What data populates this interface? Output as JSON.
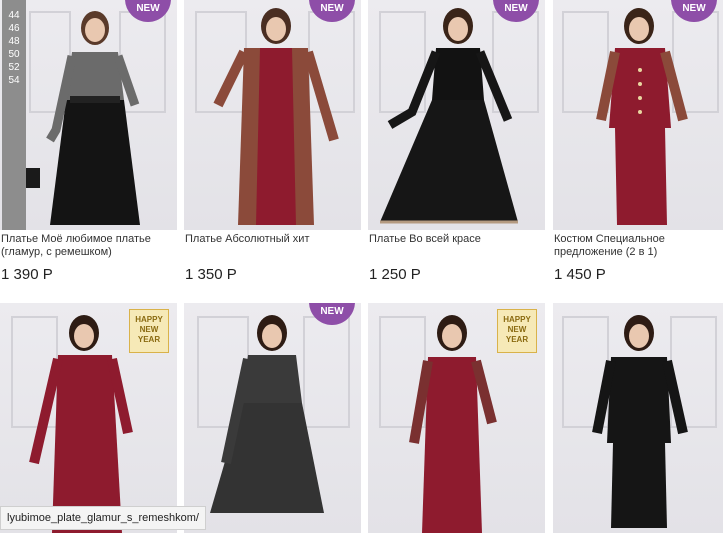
{
  "products": [
    {
      "title": "Платье Моё любимое платье (гламур, с ремешком)",
      "price": "1 390 Р",
      "badge": "NEW"
    },
    {
      "title": "Платье Абсолютный хит",
      "price": "1 350 Р",
      "badge": "NEW"
    },
    {
      "title": "Платье Во всей красе",
      "price": "1 250 Р",
      "badge": "NEW"
    },
    {
      "title": "Костюм Специальное предложение (2 в 1)",
      "price": "1 450 Р",
      "badge": "NEW"
    },
    {
      "title": "",
      "price": "",
      "badge": "HAPPY NEW YEAR"
    },
    {
      "title": "",
      "price": "",
      "badge": "NEW"
    },
    {
      "title": "",
      "price": "",
      "badge": "HAPPY NEW YEAR"
    },
    {
      "title": "",
      "price": "",
      "badge": ""
    }
  ],
  "sizes": [
    "44",
    "46",
    "48",
    "50",
    "52",
    "54"
  ],
  "status_url": "lyubimoe_plate_glamur_s_remeshkom/",
  "colors": {
    "new_badge": "#8e4ea8",
    "size_panel": "#8d8d8d"
  }
}
